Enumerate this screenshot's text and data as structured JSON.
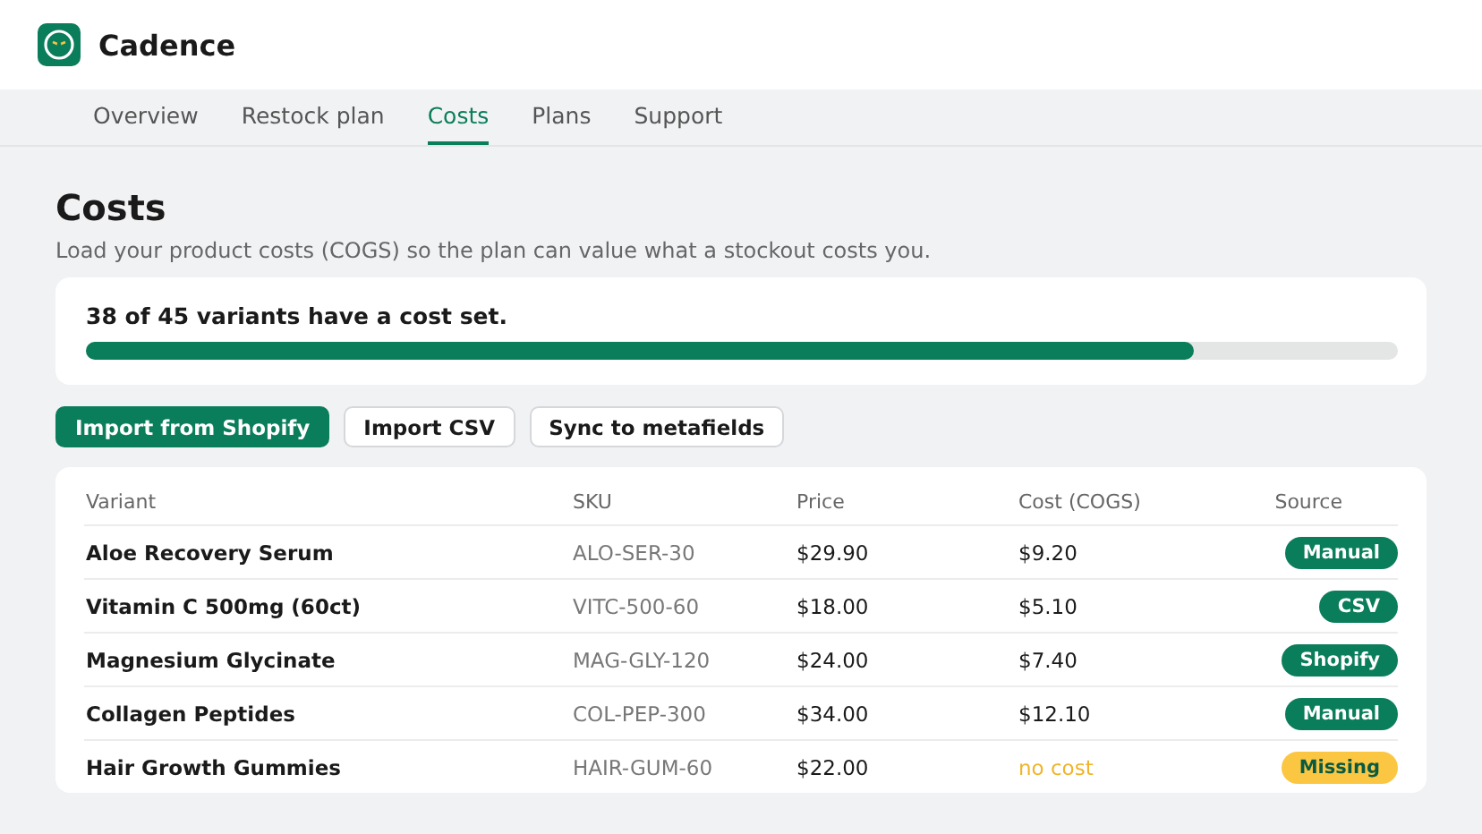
{
  "app": {
    "name": "Cadence"
  },
  "tabs": [
    {
      "label": "Overview",
      "selected": false
    },
    {
      "label": "Restock plan",
      "selected": false
    },
    {
      "label": "Costs",
      "selected": true
    },
    {
      "label": "Plans",
      "selected": false
    },
    {
      "label": "Support",
      "selected": false
    }
  ],
  "page": {
    "title": "Costs",
    "subtitle": "Load your product costs (COGS) so the plan can value what a stockout costs you."
  },
  "coverage": {
    "text": "38 of 45 variants have a cost set.",
    "level": 0.844
  },
  "actions": [
    {
      "label": "Import from Shopify",
      "kind": "primary"
    },
    {
      "label": "Import CSV",
      "kind": "secondary"
    },
    {
      "label": "Sync to metafields",
      "kind": "secondary"
    }
  ],
  "table": {
    "columns": [
      "Variant",
      "SKU",
      "Price",
      "Cost (COGS)",
      "Source"
    ],
    "rows": [
      {
        "variant": "Aloe Recovery Serum",
        "sku": "ALO-SER-30",
        "price": "$29.90",
        "cost": "$9.20",
        "source": "Manual",
        "kind": "set"
      },
      {
        "variant": "Vitamin C 500mg (60ct)",
        "sku": "VITC-500-60",
        "price": "$18.00",
        "cost": "$5.10",
        "source": "CSV",
        "kind": "set"
      },
      {
        "variant": "Magnesium Glycinate",
        "sku": "MAG-GLY-120",
        "price": "$24.00",
        "cost": "$7.40",
        "source": "Shopify",
        "kind": "set"
      },
      {
        "variant": "Collagen Peptides",
        "sku": "COL-PEP-300",
        "price": "$34.00",
        "cost": "$12.10",
        "source": "Manual",
        "kind": "set"
      },
      {
        "variant": "Hair Growth Gummies",
        "sku": "HAIR-GUM-60",
        "price": "$22.00",
        "cost": "no cost",
        "source": "Missing",
        "kind": "missing"
      }
    ]
  }
}
